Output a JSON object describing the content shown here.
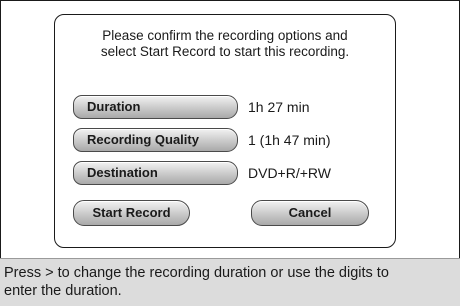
{
  "dialog": {
    "prompt_line1": "Please confirm the recording options and",
    "prompt_line2": "select Start Record to start this recording."
  },
  "options": [
    {
      "label": "Duration",
      "value": "1h 27 min"
    },
    {
      "label": "Recording Quality",
      "value": "1 (1h 47 min)"
    },
    {
      "label": "Destination",
      "value": "DVD+R/+RW"
    }
  ],
  "buttons": {
    "start_record": "Start Record",
    "cancel": "Cancel"
  },
  "help": {
    "line1": "Press > to change the recording duration or use the digits to",
    "line2": "enter the duration."
  }
}
